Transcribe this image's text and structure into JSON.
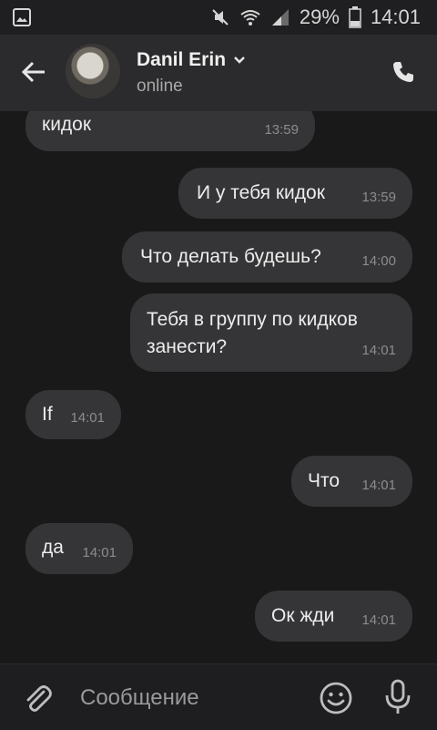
{
  "status_bar": {
    "battery_percent": "29%",
    "time": "14:01"
  },
  "header": {
    "name": "Danil Erin",
    "status": "online"
  },
  "messages": [
    {
      "direction": "in",
      "text": "кидок",
      "time": "13:59"
    },
    {
      "direction": "out",
      "text": "И у тебя кидок",
      "time": "13:59"
    },
    {
      "direction": "out",
      "text": "Что делать будешь?",
      "time": "14:00"
    },
    {
      "direction": "out",
      "text_line1": "Тебя в группу по кидков",
      "text_line2": "занести?",
      "time": "14:01"
    },
    {
      "direction": "in",
      "text": "If",
      "time": "14:01"
    },
    {
      "direction": "out",
      "text": "Что",
      "time": "14:01"
    },
    {
      "direction": "in",
      "text": "да",
      "time": "14:01"
    },
    {
      "direction": "out",
      "text": "Ок жди",
      "time": "14:01"
    }
  ],
  "composer": {
    "placeholder": "Сообщение"
  },
  "icons": {
    "back": "arrow-left-icon",
    "call": "phone-icon",
    "attach": "paperclip-icon",
    "emoji": "smiley-icon",
    "mic": "microphone-icon",
    "dropdown": "chevron-down-icon",
    "gallery": "image-icon",
    "mute": "mute-icon",
    "wifi": "wifi-icon",
    "signal": "signal-icon",
    "battery": "battery-icon"
  }
}
